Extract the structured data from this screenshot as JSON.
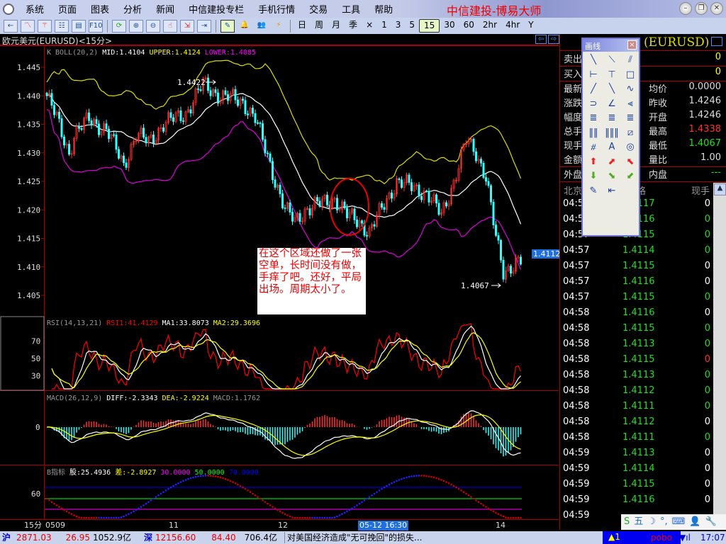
{
  "app": {
    "title": "中信建投-博易大师",
    "menu": [
      "系统",
      "页面",
      "图表",
      "分析",
      "新闻",
      "中信建投专栏",
      "手机行情",
      "交易",
      "工具",
      "帮助"
    ]
  },
  "toolbar": {
    "periods": [
      "日",
      "周",
      "月",
      "季",
      "×",
      "1",
      "3",
      "5",
      "15",
      "30",
      "60",
      "2hr",
      "4hr",
      "Y"
    ],
    "active_period": "15"
  },
  "chart_header": {
    "title": "欧元美元(EURUSD)<15分>"
  },
  "indicators": {
    "boll": {
      "name": "K  BOLL(20,2)",
      "mid": "MID:1.4104",
      "upper": "UPPER:1.4124",
      "lower": "LOWER:1.4085"
    },
    "rsi": {
      "name": "RSI(14,13,21)",
      "rsi1": "RSI1:41.4129",
      "ma1": "MA1:33.8073",
      "ma2": "MA2:29.3696"
    },
    "macd": {
      "name": "MACD(26,12,9)",
      "diff": "DIFF:-2.3343",
      "dea": "DEA:-2.9224",
      "macd": "MACD:1.1762"
    },
    "b": {
      "name": "B指标",
      "gu": "股:25.4936",
      "cha": "差:-2.8927",
      "l30": "30.0000",
      "l50": "50.0000",
      "l70": "70.0000"
    }
  },
  "chart_data": {
    "type": "candlestick",
    "price_axis": {
      "ticks": [
        "1.445",
        "1.440",
        "1.435",
        "1.430",
        "1.425",
        "1.420",
        "1.415",
        "1.410",
        "1.405"
      ],
      "range": [
        1.405,
        1.445
      ]
    },
    "rsi_axis": [
      "70",
      "50",
      "30"
    ],
    "macd_axis": [
      "0"
    ],
    "b_axis": [
      "60"
    ],
    "bar_count": 192,
    "close_keypoints": [
      [
        0,
        1.44
      ],
      [
        4,
        1.436
      ],
      [
        9,
        1.43
      ],
      [
        11,
        1.433
      ],
      [
        17,
        1.436
      ],
      [
        24,
        1.434
      ],
      [
        31,
        1.428
      ],
      [
        36,
        1.433
      ],
      [
        41,
        1.432
      ],
      [
        47,
        1.435
      ],
      [
        56,
        1.437
      ],
      [
        63,
        1.442
      ],
      [
        70,
        1.44
      ],
      [
        79,
        1.439
      ],
      [
        84,
        1.436
      ],
      [
        90,
        1.428
      ],
      [
        96,
        1.42
      ],
      [
        100,
        1.418
      ],
      [
        104,
        1.42
      ],
      [
        110,
        1.421
      ],
      [
        116,
        1.422
      ],
      [
        121,
        1.419
      ],
      [
        126,
        1.418
      ],
      [
        130,
        1.416
      ],
      [
        136,
        1.421
      ],
      [
        141,
        1.425
      ],
      [
        147,
        1.424
      ],
      [
        153,
        1.423
      ],
      [
        159,
        1.419
      ],
      [
        164,
        1.425
      ],
      [
        169,
        1.432
      ],
      [
        173,
        1.43
      ],
      [
        177,
        1.426
      ],
      [
        181,
        1.415
      ],
      [
        184,
        1.409
      ],
      [
        189,
        1.411
      ],
      [
        191,
        1.411
      ]
    ],
    "b_indicator": {
      "mid": 50,
      "amp": 42,
      "period": 86,
      "phase": 43
    },
    "annotations": {
      "high": "1.4422",
      "low": "1.4067",
      "last_price": "1.4112"
    },
    "x_labels": {
      "period": "15分",
      "d0509": "0509",
      "d11": "11",
      "d12": "12",
      "cursor": "05-12 16:30",
      "d14": "14"
    }
  },
  "note": "在这个区域还做了一张空单，长时间没有做，手痒了吧。还好，平局出场。周期太小了。",
  "quote": {
    "symbol": "(EURUSD)",
    "sell_label": "卖出",
    "sell": "0",
    "buy_label": "买入",
    "buy": "0",
    "left": [
      "最新",
      "涨跌",
      "幅度",
      "总手",
      "现手",
      "金额"
    ],
    "right": [
      {
        "l": "均价",
        "v": "0.0000"
      },
      {
        "l": "昨收",
        "v": "1.4246"
      },
      {
        "l": "开盘",
        "v": "1.4246"
      },
      {
        "l": "最高",
        "v": "1.4338"
      },
      {
        "l": "最低",
        "v": "1.4067"
      },
      {
        "l": "量比",
        "v": "1.00"
      }
    ],
    "outer_label": "外盘",
    "inner_label": "内盘",
    "inner": "---",
    "colors": {
      "high": "#ff3030",
      "low": "#20e020"
    },
    "ticks_header": {
      "time": "北京",
      "price": "格",
      "qty": "现手"
    },
    "ticks": [
      {
        "t": "04:57",
        "p": "1.4117",
        "q": "0",
        "c": "#fff"
      },
      {
        "t": "04:57",
        "p": "1.4116",
        "q": "0",
        "c": "#1ee01e"
      },
      {
        "t": "04:57",
        "p": "1.4115",
        "q": "0",
        "c": "#1ee01e"
      },
      {
        "t": "04:57",
        "p": "1.4114",
        "q": "0",
        "c": "#1ee01e"
      },
      {
        "t": "04:57",
        "p": "1.4115",
        "q": "0",
        "c": "#fff"
      },
      {
        "t": "04:57",
        "p": "1.4116",
        "q": "0",
        "c": "#fff"
      },
      {
        "t": "04:57",
        "p": "1.4115",
        "q": "0",
        "c": "#1ee01e"
      },
      {
        "t": "04:58",
        "p": "1.4116",
        "q": "0",
        "c": "#fff"
      },
      {
        "t": "04:58",
        "p": "1.4115",
        "q": "0",
        "c": "#1ee01e"
      },
      {
        "t": "04:58",
        "p": "1.4113",
        "q": "0",
        "c": "#1ee01e"
      },
      {
        "t": "04:58",
        "p": "1.4115",
        "q": "0",
        "c": "#ff3030"
      },
      {
        "t": "04:58",
        "p": "1.4113",
        "q": "0",
        "c": "#1ee01e"
      },
      {
        "t": "04:58",
        "p": "1.4112",
        "q": "0",
        "c": "#1ee01e"
      },
      {
        "t": "04:58",
        "p": "1.4111",
        "q": "0",
        "c": "#1ee01e"
      },
      {
        "t": "04:58",
        "p": "1.4112",
        "q": "0",
        "c": "#fff"
      },
      {
        "t": "04:58",
        "p": "1.4111",
        "q": "0",
        "c": "#1ee01e"
      },
      {
        "t": "04:59",
        "p": "1.4113",
        "q": "0",
        "c": "#fff"
      },
      {
        "t": "04:59",
        "p": "1.4114",
        "q": "0",
        "c": "#fff"
      },
      {
        "t": "04:59",
        "p": "1.4115",
        "q": "0",
        "c": "#fff"
      },
      {
        "t": "04:59",
        "p": "1.4116",
        "q": "0",
        "c": "#fff"
      },
      {
        "t": "04:59",
        "p": "",
        "q": "",
        "c": "#1ee01e"
      }
    ]
  },
  "drawtools": {
    "title": "画线",
    "close": "×",
    "tools": [
      "╲",
      "⟍",
      "⫽",
      "⊢",
      "⊤",
      "□",
      "╱",
      "╲",
      "∿",
      "⊃",
      "∠",
      "⫷",
      "≣",
      "≣",
      "≣",
      "‖‖",
      "‖‖‖",
      "⧄",
      "⧣",
      "A",
      "◎",
      "⬆",
      "⬈",
      "⬉",
      "⬇",
      "⬊",
      "⬋",
      "✎",
      "⇤"
    ]
  },
  "ime": {
    "items": [
      "S",
      "五",
      "☽",
      "°,",
      "⌨",
      "👤",
      "🔧"
    ]
  },
  "status": {
    "sh_label": "沪",
    "sh_index": "2871.03",
    "sh_change": "26.95",
    "sh_amount": "1052.9亿",
    "sz_label": "深",
    "sz_index": "12156.60",
    "sz_change": "84.40",
    "sz_amount": "706.4亿",
    "news": "对美国经济造成\"无可挽回\"的损失...",
    "alert": "1",
    "brand": "pobo",
    "time": "17:07"
  }
}
